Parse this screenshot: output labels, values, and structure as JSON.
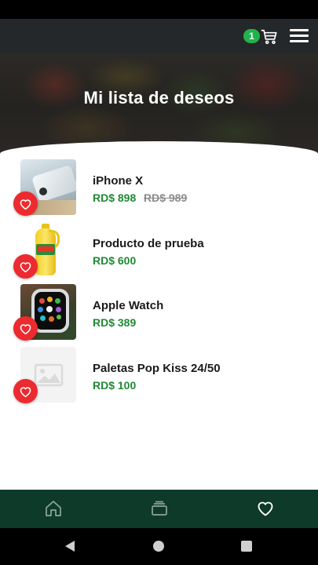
{
  "header": {
    "cart_count": "1",
    "cart_icon": "shopping-cart-icon",
    "menu_icon": "hamburger-menu-icon"
  },
  "hero": {
    "title": "Mi lista de deseos"
  },
  "wishlist": {
    "items": [
      {
        "name": "iPhone X",
        "price": "RD$ 898",
        "old_price": "RD$ 989",
        "image": "iphone-x-photo"
      },
      {
        "name": "Producto de prueba",
        "price": "RD$ 600",
        "image": "oil-bottle-photo"
      },
      {
        "name": "Apple Watch",
        "price": "RD$ 389",
        "image": "apple-watch-photo"
      },
      {
        "name": "Paletas Pop Kiss 24/50",
        "price": "RD$ 100",
        "image": "image-placeholder"
      }
    ]
  },
  "bottom_nav": {
    "items": [
      "home-icon",
      "catalog-icon",
      "heart-icon"
    ],
    "active": "heart-icon"
  },
  "colors": {
    "app_bar": "#25282a",
    "price_green": "#1f8a33",
    "favorite_red": "#ec2a2f",
    "bottom_nav": "#0e3a2a",
    "badge_green": "#22b24c"
  }
}
